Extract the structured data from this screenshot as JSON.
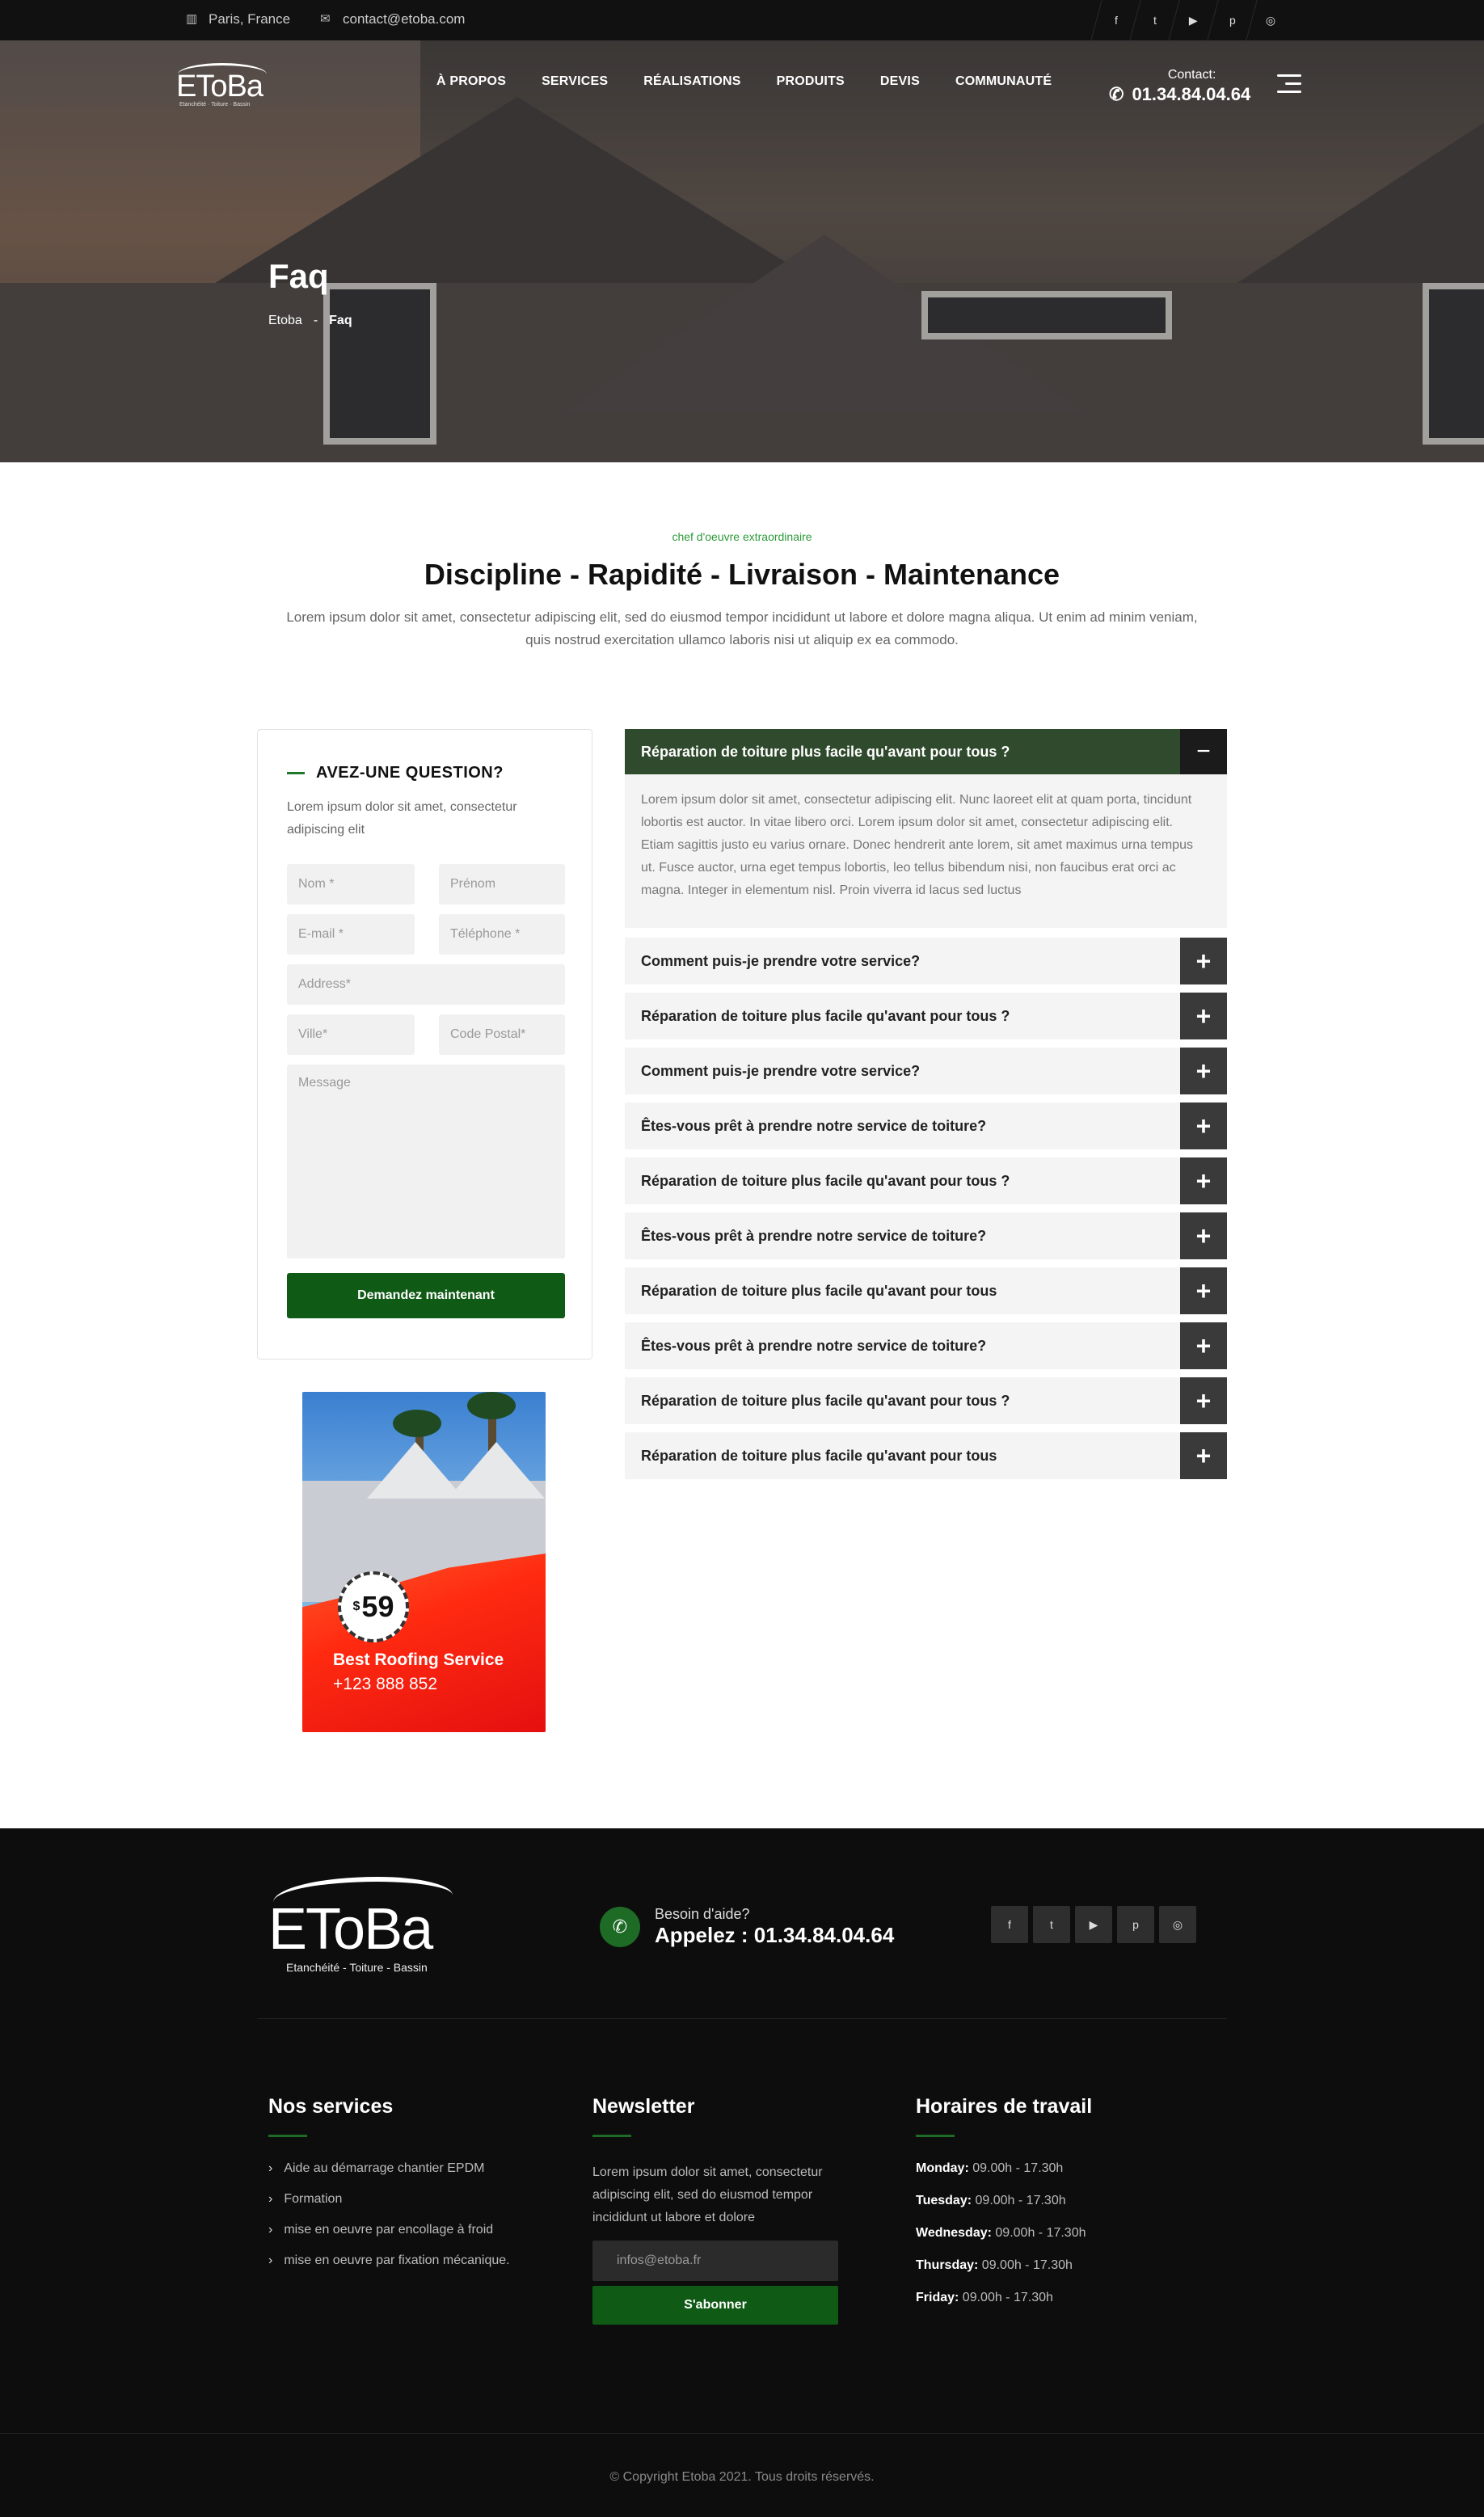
{
  "topbar": {
    "location": "Paris, France",
    "email": "contact@etoba.com",
    "social": [
      "f",
      "t",
      "▶",
      "p",
      "◎"
    ]
  },
  "header": {
    "logo_text": "EToBa",
    "logo_tagline": "Etanchéité · Toiture · Bassin",
    "nav": [
      "À PROPOS",
      "SERVICES",
      "RÉALISATIONS",
      "PRODUITS",
      "DEVIS",
      "COMMUNAUTÉ"
    ],
    "contact_label": "Contact:",
    "contact_phone": "01.34.84.04.64"
  },
  "hero": {
    "title": "Faq",
    "breadcrumb": [
      "Etoba",
      "-",
      "Faq"
    ]
  },
  "intro": {
    "subtitle": "chef d'oeuvre extraordinaire",
    "headline": "Discipline - Rapidité - Livraison - Maintenance",
    "text": "Lorem ipsum dolor sit amet, consectetur adipiscing elit, sed do eiusmod tempor incididunt ut labore et dolore magna aliqua. Ut enim ad minim veniam, quis nostrud exercitation ullamco laboris nisi ut aliquip ex ea commodo."
  },
  "form": {
    "title": "AVEZ-UNE QUESTION?",
    "desc": "Lorem ipsum dolor sit amet, consectetur adipiscing elit",
    "placeholders": {
      "nom": "Nom *",
      "prenom": "Prénom",
      "email": "E-mail *",
      "telephone": "Téléphone *",
      "address": "Address*",
      "ville": "Ville*",
      "code_postal": "Code Postal*",
      "message": "Message"
    },
    "submit": "Demandez maintenant"
  },
  "ad": {
    "currency": "$",
    "price": "59",
    "line1": "Best Roofing Service",
    "line2": "+123 888 852"
  },
  "faq": {
    "open": {
      "question": "Réparation de toiture plus facile qu'avant pour tous ?",
      "toggle": "−",
      "answer": "Lorem ipsum dolor sit amet, consectetur adipiscing elit. Nunc laoreet elit at quam porta, tincidunt lobortis est auctor. In vitae libero orci. Lorem ipsum dolor sit amet, consectetur adipiscing elit. Etiam sagittis justo eu varius ornare. Donec hendrerit ante lorem, sit amet maximus urna tempus ut. Fusce auctor, urna eget tempus lobortis, leo tellus bibendum nisi, non faucibus erat orci ac magna. Integer in elementum nisl. Proin viverra id lacus sed luctus"
    },
    "items": [
      "Comment puis-je prendre votre service?",
      "Réparation de toiture plus facile qu'avant pour tous ?",
      "Comment puis-je prendre votre service?",
      "Êtes-vous prêt à prendre notre service de toiture?",
      "Réparation de toiture plus facile qu'avant pour tous ?",
      "Êtes-vous prêt à prendre notre service de toiture?",
      "Réparation de toiture plus facile qu'avant pour tous",
      "Êtes-vous prêt à prendre notre service de toiture?",
      "Réparation de toiture plus facile qu'avant pour tous ?",
      "Réparation de toiture plus facile qu'avant pour tous"
    ],
    "plus": "+"
  },
  "footer": {
    "logo_text": "EToBa",
    "logo_tagline": "Etanchéité - Toiture - Bassin",
    "help_label": "Besoin d'aide?",
    "help_phone": "Appelez : 01.34.84.04.64",
    "social": [
      "f",
      "t",
      "▶",
      "p",
      "◎"
    ],
    "services_title": "Nos services",
    "services": [
      "Aide au démarrage chantier EPDM",
      "Formation",
      "mise en oeuvre par encollage à froid",
      "mise en oeuvre par fixation mécanique."
    ],
    "newsletter_title": "Newsletter",
    "newsletter_text": "Lorem ipsum dolor sit amet, consectetur adipiscing elit, sed do eiusmod tempor incididunt ut labore et dolore",
    "newsletter_placeholder": "infos@etoba.fr",
    "newsletter_button": "S'abonner",
    "hours_title": "Horaires de travail",
    "hours": [
      {
        "day": "Monday:",
        "time": "09.00h - 17.30h"
      },
      {
        "day": "Tuesday:",
        "time": "09.00h - 17.30h"
      },
      {
        "day": "Wednesday:",
        "time": "09.00h - 17.30h"
      },
      {
        "day": "Thursday:",
        "time": "09.00h - 17.30h"
      },
      {
        "day": "Friday:",
        "time": "09.00h - 17.30h"
      }
    ],
    "copyright": "© Copyright Etoba 2021. Tous droits réservés."
  },
  "colors": {
    "accent_green": "#0f5a14",
    "faq_active": "#2f4a2c",
    "footer_bg": "#0d0d0d"
  }
}
